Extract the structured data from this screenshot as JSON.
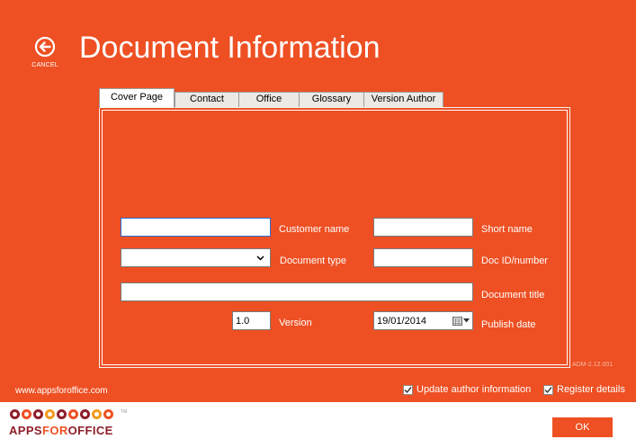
{
  "header": {
    "back_label": "CANCEL",
    "title": "Document Information"
  },
  "tabs": [
    {
      "label": "Cover Page",
      "active": true
    },
    {
      "label": "Contact",
      "active": false
    },
    {
      "label": "Office",
      "active": false
    },
    {
      "label": "Glossary",
      "active": false
    },
    {
      "label": "Version Author",
      "active": false
    }
  ],
  "form": {
    "customer_name": {
      "label": "Customer name",
      "value": ""
    },
    "short_name": {
      "label": "Short name",
      "value": ""
    },
    "document_type": {
      "label": "Document type",
      "value": ""
    },
    "doc_id": {
      "label": "Doc ID/number",
      "value": ""
    },
    "document_title": {
      "label": "Document title",
      "value": ""
    },
    "version": {
      "label": "Version",
      "value": "1.0"
    },
    "publish_date": {
      "label": "Publish date",
      "value": "19/01/2014"
    }
  },
  "build_version": "ADM-2.12.001",
  "footer": {
    "site_url": "www.appsforoffice.com",
    "update_author_label": "Update author information",
    "update_author_checked": true,
    "register_details_label": "Register details",
    "register_details_checked": true
  },
  "logo": {
    "text_part1": "APPS",
    "text_part2": "FOR",
    "text_part3": "OFFICE",
    "trademark": "TM",
    "dot_colors": [
      "#8e1f2a",
      "#ee5023",
      "#8e1f2a",
      "#f39a1e",
      "#8e1f2a",
      "#ee5023",
      "#8e1f2a",
      "#f39a1e",
      "#ee5023"
    ]
  },
  "ok_label": "OK",
  "colors": {
    "accent": "#ee5023",
    "logo_dark": "#8e1f2a",
    "logo_light": "#f39a1e"
  }
}
